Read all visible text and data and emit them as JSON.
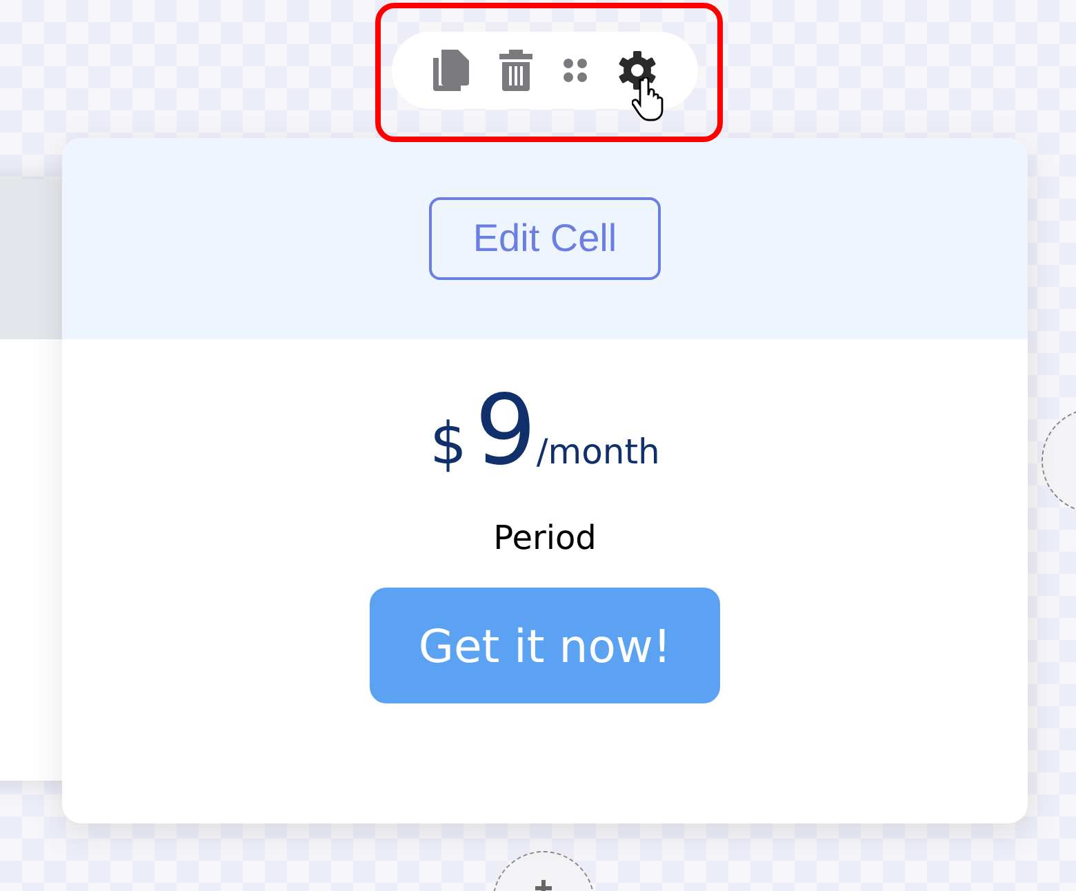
{
  "card": {
    "edit_button": "Edit Cell",
    "currency": "$",
    "amount": "9",
    "unit": "/month",
    "period": "Period",
    "action_button": "Get it now!"
  }
}
